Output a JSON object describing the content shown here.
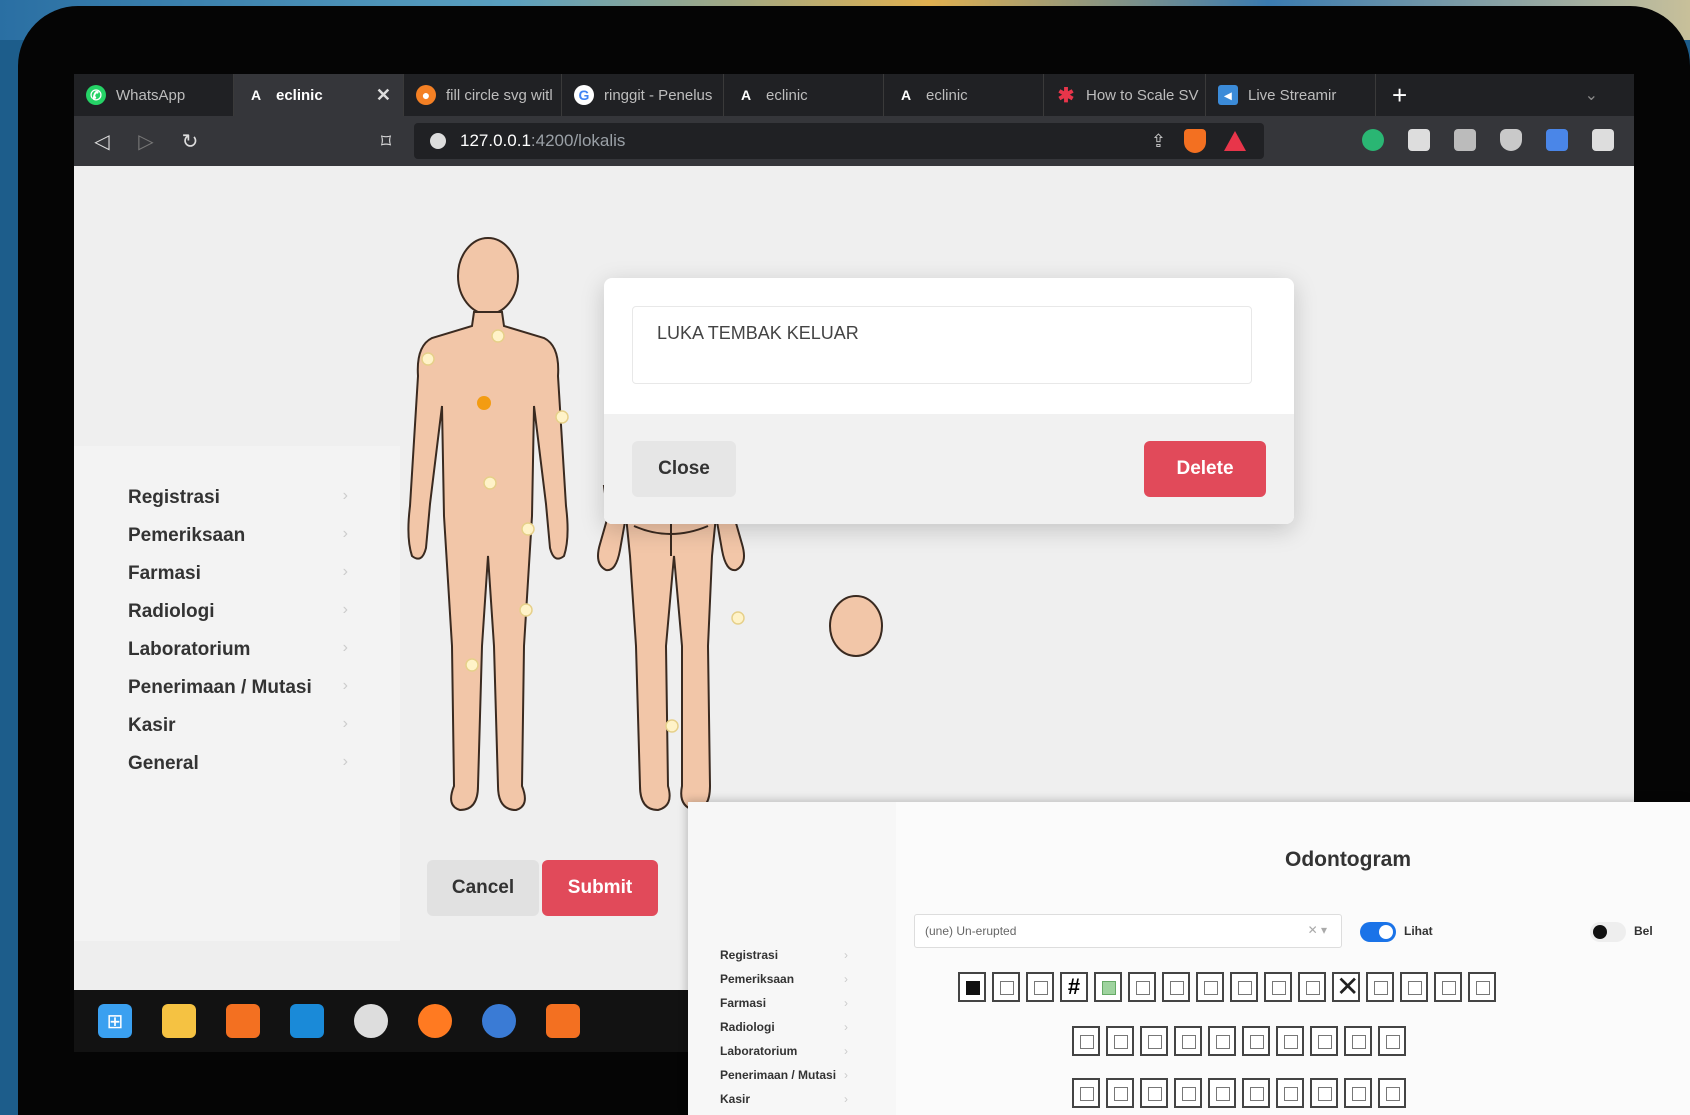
{
  "browser": {
    "tabs": [
      {
        "label": "WhatsApp",
        "icon": "whatsapp-icon",
        "color": "#25d366"
      },
      {
        "label": "eclinic",
        "icon": "angular-icon",
        "color": "#ffffff",
        "active": true
      },
      {
        "label": "fill circle svg witl",
        "icon": "stackoverflow-icon",
        "color": "#f48024"
      },
      {
        "label": "ringgit - Penelus",
        "icon": "google-icon",
        "color": "#ffffff"
      },
      {
        "label": "eclinic",
        "icon": "angular-icon",
        "color": "#ffffff"
      },
      {
        "label": "eclinic",
        "icon": "angular-icon",
        "color": "#ffffff"
      },
      {
        "label": "How to Scale SV",
        "icon": "star-icon",
        "color": "#e8354a"
      },
      {
        "label": "Live Streamir",
        "icon": "stream-icon",
        "color": "#3b8bd8"
      }
    ],
    "url_host": "127.0.0.1",
    "url_path": ":4200/lokalis"
  },
  "sidebar": {
    "items": [
      "Registrasi",
      "Pemeriksaan",
      "Farmasi",
      "Radiologi",
      "Laboratorium",
      "Penerimaan / Mutasi",
      "Kasir",
      "General"
    ]
  },
  "modal": {
    "note": "LUKA TEMBAK KELUAR",
    "close_label": "Close",
    "delete_label": "Delete"
  },
  "form": {
    "cancel_label": "Cancel",
    "submit_label": "Submit"
  },
  "colors": {
    "accent_red": "#e14a5a",
    "skin": "#f2c6a8",
    "marker_active": "#f39c12"
  },
  "odontogram": {
    "title": "Odontogram",
    "select_value": "(une) Un-erupted",
    "toggle_label": "Lihat",
    "toggle2_label": "Bel",
    "menu": [
      "Registrasi",
      "Pemeriksaan",
      "Farmasi",
      "Radiologi",
      "Laboratorium",
      "Penerimaan / Mutasi",
      "Kasir"
    ]
  }
}
